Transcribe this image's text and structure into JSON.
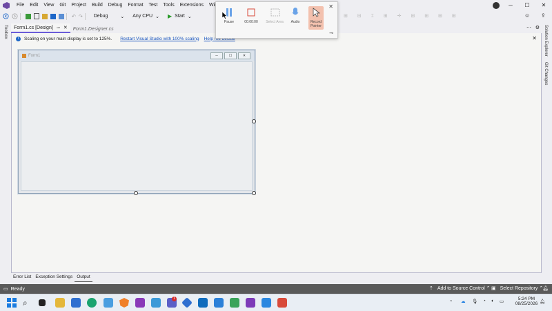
{
  "menu": [
    "File",
    "Edit",
    "View",
    "Git",
    "Project",
    "Build",
    "Debug",
    "Format",
    "Test",
    "Tools",
    "Extensions",
    "Window",
    "He"
  ],
  "toolbar": {
    "config": "Debug",
    "platform": "Any CPU",
    "start": "Start"
  },
  "recorder": {
    "pause": "Pause",
    "timer": "00:00:00",
    "select_area": "Select Area",
    "audio": "Audio",
    "record_pointer": "Record Pointer"
  },
  "tabs": [
    {
      "label": "Form1.cs [Design]"
    },
    {
      "label": "Form1.Designer.cs"
    }
  ],
  "left_rail": {
    "label": "Toolbox"
  },
  "right_rail": {
    "solution": "Solution Explorer",
    "git": "Git Changes"
  },
  "infobar": {
    "message": "Scaling on your main display is set to 125%.",
    "restart_link": "Restart Visual Studio with 100% scaling",
    "help_link": "Help me decide"
  },
  "form": {
    "title": "Form1"
  },
  "bottom_tabs": [
    "Error List",
    "Exception Settings",
    "Output"
  ],
  "status": {
    "ready": "Ready",
    "source_control": "Add to Source Control",
    "select_repo": "Select Repository"
  },
  "taskbar": {
    "time": "5:24 PM",
    "date": "08/25/2026",
    "badge_count": "1"
  },
  "colors": {
    "accent": "#6a5cd8",
    "status_bar": "#5a5a5a",
    "link": "#1b56bf",
    "record_active": "#f3c1ae"
  }
}
